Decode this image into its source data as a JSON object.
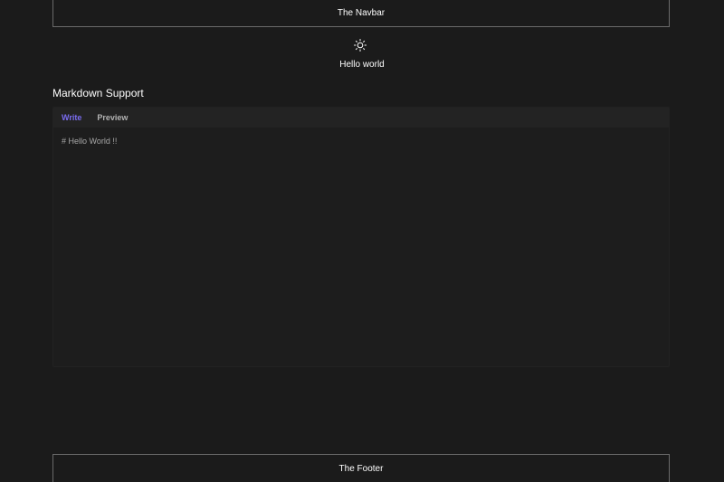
{
  "navbar": {
    "label": "The Navbar"
  },
  "theme_toggle": {
    "icon": "sun-icon"
  },
  "greeting": "Hello world",
  "section": {
    "title": "Markdown Support"
  },
  "editor": {
    "tabs": [
      {
        "label": "Write",
        "active": true
      },
      {
        "label": "Preview",
        "active": false
      }
    ],
    "content": "# Hello World !!"
  },
  "footer": {
    "label": "The Footer"
  },
  "colors": {
    "background": "#1b1b1b",
    "accent": "#7a6cf0",
    "border": "#6a6a6a"
  }
}
